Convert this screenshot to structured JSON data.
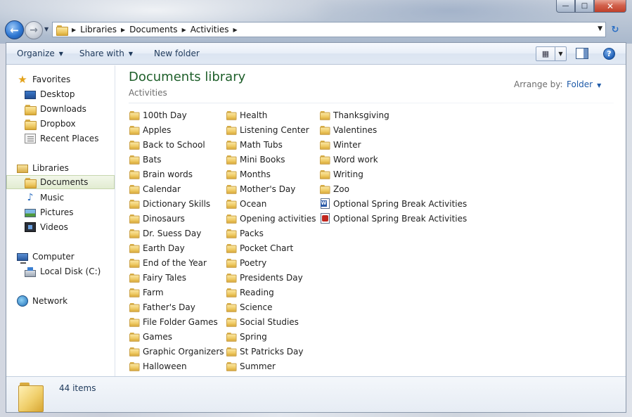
{
  "window": {
    "caption_buttons": {
      "minimize": "—",
      "maximize": "□",
      "close": "✕"
    }
  },
  "address": {
    "back_glyph": "←",
    "forward_glyph": "→",
    "recent_glyph": "▼",
    "breadcrumbs": [
      "Libraries",
      "Documents",
      "Activities"
    ],
    "separator": "▶",
    "dropdown_glyph": "▼",
    "refresh_glyph": "↻"
  },
  "toolbar": {
    "organize": "Organize",
    "share_with": "Share with",
    "new_folder": "New folder",
    "arrow": "▼",
    "view_icon": "▦",
    "help": "?"
  },
  "nav": {
    "favorites": {
      "label": "Favorites",
      "items": [
        "Desktop",
        "Downloads",
        "Dropbox",
        "Recent Places"
      ]
    },
    "libraries": {
      "label": "Libraries",
      "items": [
        "Documents",
        "Music",
        "Pictures",
        "Videos"
      ],
      "selected": "Documents"
    },
    "computer": {
      "label": "Computer",
      "items": [
        "Local Disk (C:)"
      ]
    },
    "network": {
      "label": "Network"
    }
  },
  "content": {
    "title": "Documents library",
    "subtitle": "Activities",
    "arrange_label": "Arrange by:",
    "arrange_value": "Folder",
    "columns": [
      [
        {
          "name": "100th Day",
          "type": "folder"
        },
        {
          "name": "Apples",
          "type": "folder"
        },
        {
          "name": "Back to School",
          "type": "folder"
        },
        {
          "name": "Bats",
          "type": "folder"
        },
        {
          "name": "Brain words",
          "type": "folder"
        },
        {
          "name": "Calendar",
          "type": "folder"
        },
        {
          "name": "Dictionary Skills",
          "type": "folder"
        },
        {
          "name": "Dinosaurs",
          "type": "folder"
        },
        {
          "name": "Dr. Suess Day",
          "type": "folder"
        },
        {
          "name": "Earth Day",
          "type": "folder"
        },
        {
          "name": "End of the Year",
          "type": "folder"
        },
        {
          "name": "Fairy Tales",
          "type": "folder"
        },
        {
          "name": "Farm",
          "type": "folder"
        },
        {
          "name": "Father's Day",
          "type": "folder"
        },
        {
          "name": "File Folder Games",
          "type": "folder"
        },
        {
          "name": "Games",
          "type": "folder"
        },
        {
          "name": "Graphic Organizers",
          "type": "folder"
        },
        {
          "name": "Halloween",
          "type": "folder"
        }
      ],
      [
        {
          "name": "Health",
          "type": "folder"
        },
        {
          "name": "Listening Center",
          "type": "folder"
        },
        {
          "name": "Math Tubs",
          "type": "folder"
        },
        {
          "name": "Mini Books",
          "type": "folder"
        },
        {
          "name": "Months",
          "type": "folder"
        },
        {
          "name": "Mother's Day",
          "type": "folder"
        },
        {
          "name": "Ocean",
          "type": "folder"
        },
        {
          "name": "Opening activities",
          "type": "folder"
        },
        {
          "name": "Packs",
          "type": "folder"
        },
        {
          "name": "Pocket Chart",
          "type": "folder"
        },
        {
          "name": "Poetry",
          "type": "folder"
        },
        {
          "name": "Presidents Day",
          "type": "folder"
        },
        {
          "name": "Reading",
          "type": "folder"
        },
        {
          "name": "Science",
          "type": "folder"
        },
        {
          "name": "Social Studies",
          "type": "folder"
        },
        {
          "name": "Spring",
          "type": "folder"
        },
        {
          "name": "St Patricks Day",
          "type": "folder"
        },
        {
          "name": "Summer",
          "type": "folder"
        }
      ],
      [
        {
          "name": "Thanksgiving",
          "type": "folder"
        },
        {
          "name": "Valentines",
          "type": "folder"
        },
        {
          "name": "Winter",
          "type": "folder"
        },
        {
          "name": "Word work",
          "type": "folder"
        },
        {
          "name": "Writing",
          "type": "folder"
        },
        {
          "name": "Zoo",
          "type": "folder"
        },
        {
          "name": "Optional Spring Break Activities",
          "type": "word"
        },
        {
          "name": "Optional Spring Break Activities",
          "type": "pdf"
        }
      ]
    ]
  },
  "details": {
    "item_count": "44 items"
  },
  "colors": {
    "title_green": "#1e5f2a",
    "link_blue": "#1e5aa8",
    "toolbar_text": "#1e395b"
  }
}
